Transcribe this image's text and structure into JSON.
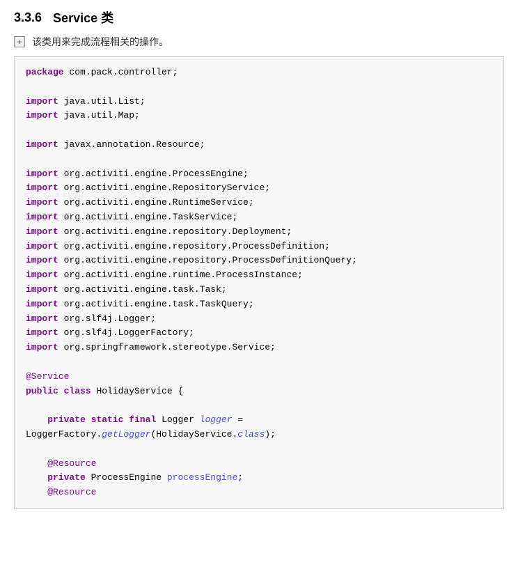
{
  "header": {
    "section_number": "3.3.6",
    "section_title": "Service 类"
  },
  "description": {
    "expand_icon": "+",
    "text": "该类用来完成流程相关的操作。"
  },
  "code": {
    "lines": []
  }
}
